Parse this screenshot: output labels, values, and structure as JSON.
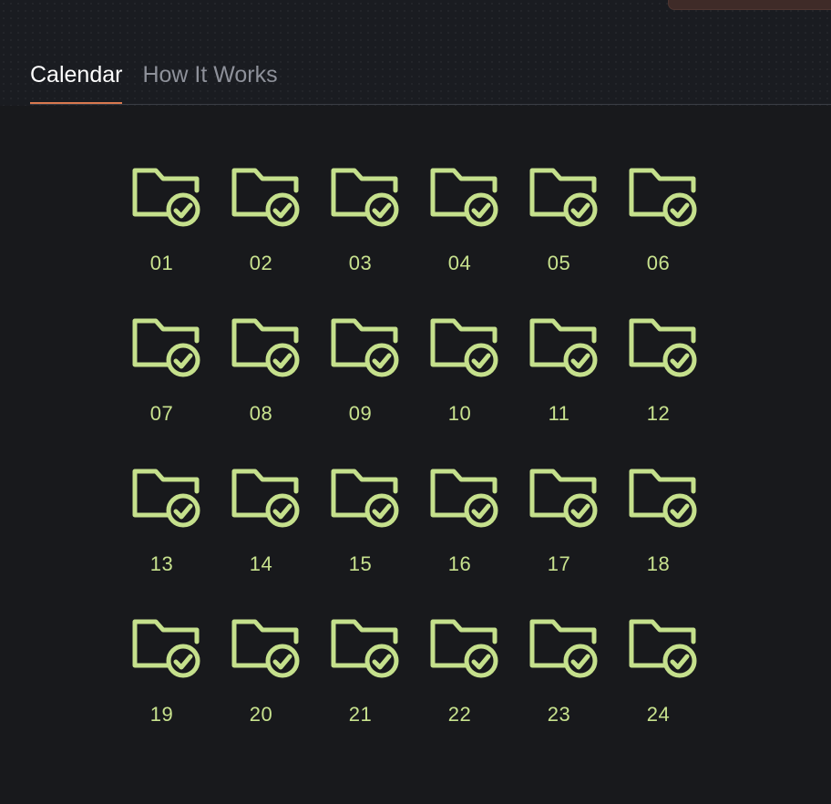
{
  "tabs": [
    {
      "label": "Calendar",
      "active": true
    },
    {
      "label": "How It Works",
      "active": false
    }
  ],
  "calendar": {
    "icon": "folder-check-icon",
    "accent_color": "#c5e08c",
    "days": [
      "01",
      "02",
      "03",
      "04",
      "05",
      "06",
      "07",
      "08",
      "09",
      "10",
      "11",
      "12",
      "13",
      "14",
      "15",
      "16",
      "17",
      "18",
      "19",
      "20",
      "21",
      "22",
      "23",
      "24"
    ]
  }
}
